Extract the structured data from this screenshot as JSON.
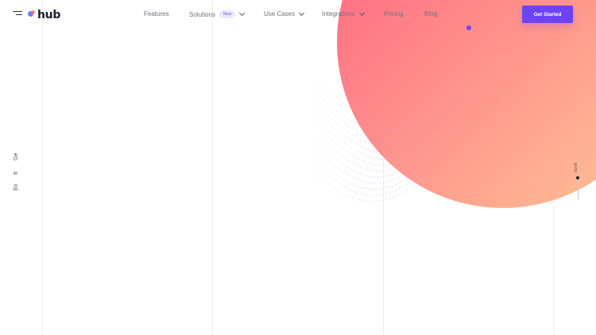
{
  "brand": {
    "logo_text": "hub",
    "colors": {
      "accent": "#6e43f5",
      "circle_start": "#ff5f82",
      "circle_end": "#ffc796"
    }
  },
  "nav": {
    "features": "Features",
    "solutions": "Solutions",
    "solutions_badge": "New",
    "use_cases": "Use Cases",
    "integrations": "Integrations",
    "pricing": "Pricing",
    "blog": "Blog"
  },
  "cta": {
    "label": "Get Started"
  },
  "languages": [
    "En",
    "fr",
    "Ge"
  ],
  "scroll_indicator": {
    "label": "scroll"
  },
  "icons": {
    "menu": "hamburger-menu-icon",
    "chevron": "chevron-down-icon"
  }
}
